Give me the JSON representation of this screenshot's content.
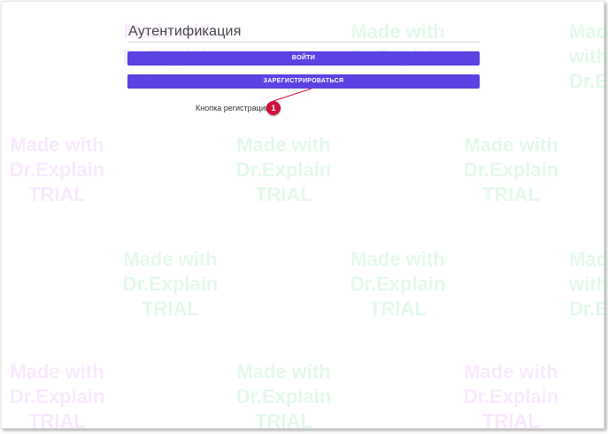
{
  "title": "Аутентификация",
  "buttons": {
    "login": "ВОЙТИ",
    "register": "ЗАРЕГИСТРИРОВАТЬСЯ"
  },
  "callout": {
    "label": "Кнопка регистрации",
    "number": "1",
    "color": "#d0103a"
  },
  "watermark": {
    "line1": "Made with",
    "line2": "Dr.Explain",
    "line3": "TRIAL"
  },
  "colors": {
    "button": "#5b43e3"
  }
}
